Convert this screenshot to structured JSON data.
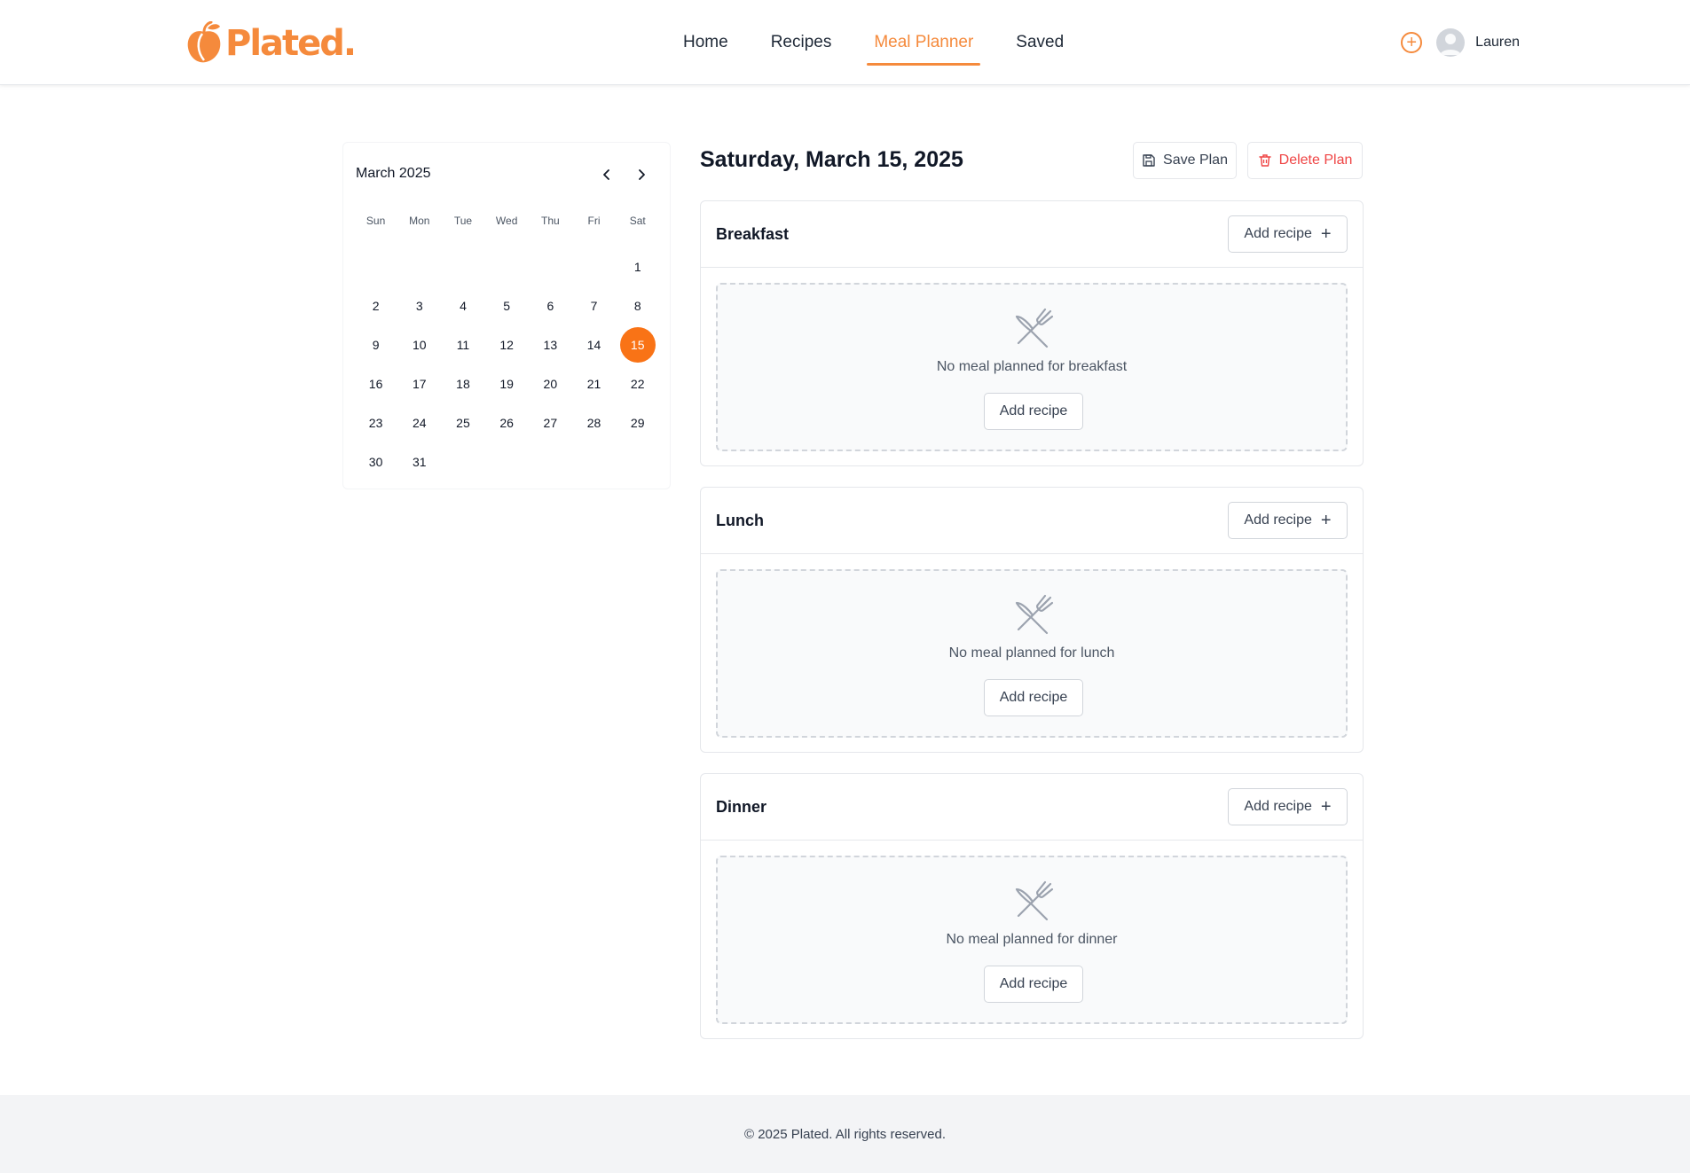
{
  "brand": {
    "name": "Plated.",
    "color": "#f58a3c"
  },
  "nav": {
    "items": [
      {
        "label": "Home",
        "active": false
      },
      {
        "label": "Recipes",
        "active": false
      },
      {
        "label": "Meal Planner",
        "active": true
      },
      {
        "label": "Saved",
        "active": false
      }
    ]
  },
  "user": {
    "name": "Lauren",
    "add_icon": "plus-circle-icon",
    "avatar_icon": "user-avatar-icon"
  },
  "calendar": {
    "month_label": "March 2025",
    "prev_icon": "chevron-left-icon",
    "next_icon": "chevron-right-icon",
    "weekdays": [
      "Sun",
      "Mon",
      "Tue",
      "Wed",
      "Thu",
      "Fri",
      "Sat"
    ],
    "days": [
      "",
      "",
      "",
      "",
      "",
      "",
      "1",
      "2",
      "3",
      "4",
      "5",
      "6",
      "7",
      "8",
      "9",
      "10",
      "11",
      "12",
      "13",
      "14",
      "15",
      "16",
      "17",
      "18",
      "19",
      "20",
      "21",
      "22",
      "23",
      "24",
      "25",
      "26",
      "27",
      "28",
      "29",
      "30",
      "31"
    ],
    "selected_day": "15",
    "selected_color": "#f97316"
  },
  "planner": {
    "date_title": "Saturday, March 15, 2025",
    "save_label": "Save Plan",
    "delete_label": "Delete Plan",
    "danger_color": "#ef4444",
    "meals": [
      {
        "title": "Breakfast",
        "add_label": "Add recipe",
        "empty_text": "No meal planned for breakfast",
        "empty_add_label": "Add recipe"
      },
      {
        "title": "Lunch",
        "add_label": "Add recipe",
        "empty_text": "No meal planned for lunch",
        "empty_add_label": "Add recipe"
      },
      {
        "title": "Dinner",
        "add_label": "Add recipe",
        "empty_text": "No meal planned for dinner",
        "empty_add_label": "Add recipe"
      }
    ],
    "empty_icon": "utensils-crossed-icon"
  },
  "footer": {
    "text": "© 2025 Plated. All rights reserved."
  }
}
